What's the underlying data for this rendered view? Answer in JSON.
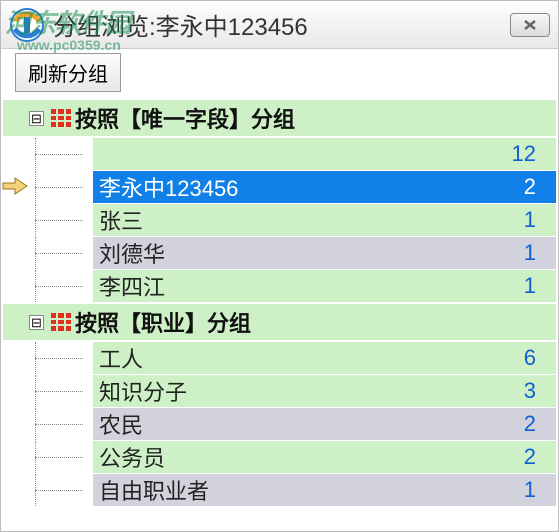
{
  "watermark": {
    "text": "河东软件园",
    "url": "www.pc0359.cn"
  },
  "window": {
    "title": "分组浏览:李永中123456"
  },
  "toolbar": {
    "refresh_label": "刷新分组"
  },
  "groups": [
    {
      "label": "按照【唯一字段】分组",
      "expanded": true,
      "rows": [
        {
          "name": "",
          "count": 12,
          "alt": "green",
          "selected": false
        },
        {
          "name": "李永中123456",
          "count": 2,
          "alt": "selected",
          "selected": true
        },
        {
          "name": "张三",
          "count": 1,
          "alt": "green",
          "selected": false
        },
        {
          "name": "刘德华",
          "count": 1,
          "alt": "grey",
          "selected": false
        },
        {
          "name": "李四江",
          "count": 1,
          "alt": "green",
          "selected": false
        }
      ]
    },
    {
      "label": "按照【职业】分组",
      "expanded": true,
      "rows": [
        {
          "name": "工人",
          "count": 6,
          "alt": "green",
          "selected": false
        },
        {
          "name": "知识分子",
          "count": 3,
          "alt": "green",
          "selected": false
        },
        {
          "name": "农民",
          "count": 2,
          "alt": "grey",
          "selected": false
        },
        {
          "name": "公务员",
          "count": 2,
          "alt": "green",
          "selected": false
        },
        {
          "name": "自由职业者",
          "count": 1,
          "alt": "grey",
          "selected": false
        }
      ]
    }
  ]
}
